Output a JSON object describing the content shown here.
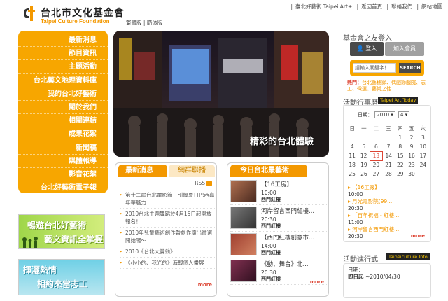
{
  "header": {
    "logo_zh": "台北市文化基金會",
    "logo_en": "Taipei Culture Foundation",
    "top_links": [
      "臺北好藝術 Taipei Art+",
      "返回首頁",
      "聯絡我們",
      "網站地圖"
    ],
    "lang": [
      "繁體版",
      "簡体版"
    ]
  },
  "nav": {
    "items": [
      "最新消息",
      "節目資訊",
      "主題活動",
      "台北藝文地理資料庫",
      "我的台北好藝術",
      "關於我們",
      "相關連結",
      "成果花絮",
      "新聞稿",
      "媒體報導",
      "影音花絮",
      "台北好藝術電子報"
    ]
  },
  "banners": {
    "b1_line1": "暢遊台北好藝術",
    "b1_line2": "藝文資訊全掌握",
    "b2_line1": "揮灑熱情",
    "b2_line2": "相約來當志工"
  },
  "hero": {
    "caption": "精彩的台北體驗"
  },
  "news": {
    "tab_active": "最新消息",
    "tab_other": "網群聯播",
    "rss": "RSS",
    "items": [
      "第十二屆台北電影節　引爆夏日巴西嘉年華魅力",
      "2010台北主題舞蹈於4月15日起開放報名！",
      "2010年兒童藝術創作暨劇作演出徵選開始囉～",
      "2010《台北大賞翁》",
      "《小小的、我光的》海報個人畫展"
    ],
    "more": "more"
  },
  "today": {
    "title": "今日台北最藝術",
    "events": [
      {
        "title": "【16工房】",
        "time": "10:00",
        "place": "西門紅樓"
      },
      {
        "title": "河岸留言西門紅樓...",
        "time": "20:30",
        "place": "西門紅樓"
      },
      {
        "title": "【西門紅樓創意市...",
        "time": "14:00",
        "place": "西門紅樓"
      },
      {
        "title": "《動、舞台》北...",
        "time": "20:30",
        "place": "西門紅樓"
      }
    ],
    "more": "more"
  },
  "right": {
    "member_title": "基金會之友登入",
    "login": "登入",
    "join": "加入會員",
    "search_placeholder": "請輸入關鍵字！",
    "search_btn": "SEARCH",
    "hot_label": "熱門：",
    "hot_links": "台北藝穗節、偶戲節戲院、志工、徵選、藝術之徒",
    "cal_title": "活動行事曆",
    "cal_badge": "Taipei Art Today",
    "cal_date_label": "日期：",
    "cal_year": "2010",
    "cal_month": "4",
    "weekdays": [
      "日",
      "一",
      "二",
      "三",
      "四",
      "五",
      "六"
    ],
    "weeks": [
      [
        "",
        "",
        "",
        "",
        "1",
        "2",
        "3"
      ],
      [
        "4",
        "5",
        "6",
        "7",
        "8",
        "9",
        "10"
      ],
      [
        "11",
        "12",
        "13",
        "14",
        "15",
        "16",
        "17"
      ],
      [
        "18",
        "19",
        "20",
        "21",
        "22",
        "23",
        "24"
      ],
      [
        "25",
        "26",
        "27",
        "28",
        "29",
        "30",
        ""
      ]
    ],
    "today": "13",
    "cal_events": [
      {
        "text": "▸ 【16工廠】",
        "orange": true
      },
      {
        "text": "10:00",
        "orange": false
      },
      {
        "text": "▸ 月光電影院(99...",
        "orange": true
      },
      {
        "text": "20:30",
        "orange": false
      },
      {
        "text": "▸ 「百年祝福 - 紅樓...",
        "orange": true
      },
      {
        "text": "11:00",
        "orange": false
      },
      {
        "text": "▸ 河岸留言西門紅樓...",
        "orange": true
      },
      {
        "text": "20:30",
        "orange": false
      }
    ],
    "cal_more": "more",
    "act_title": "活動進行式",
    "act_badge": "Taipeiculture Info",
    "act_line1": "日期：",
    "act_line2_label": "即日起",
    "act_line2_val": "~2010/04/30"
  },
  "colors": {
    "accent": "#f7a600",
    "dark": "#4a4a4a",
    "red": "#d43"
  }
}
